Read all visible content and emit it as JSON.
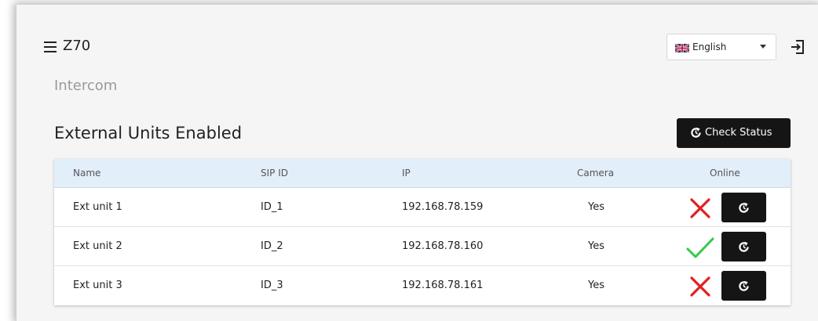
{
  "header": {
    "app_title": "Z70",
    "language": "English"
  },
  "section_title": "Intercom",
  "card": {
    "title": "External Units Enabled",
    "check_status_label": "Check Status"
  },
  "table": {
    "columns": [
      "Name",
      "SIP ID",
      "IP",
      "Camera",
      "Online"
    ],
    "rows": [
      {
        "name": "Ext unit 1",
        "sip_id": "ID_1",
        "ip": "192.168.78.159",
        "camera": "Yes",
        "online": false
      },
      {
        "name": "Ext unit 2",
        "sip_id": "ID_2",
        "ip": "192.168.78.160",
        "camera": "Yes",
        "online": true
      },
      {
        "name": "Ext unit 3",
        "sip_id": "ID_3",
        "ip": "192.168.78.161",
        "camera": "Yes",
        "online": false
      }
    ]
  },
  "colors": {
    "offline": "#e02020",
    "online": "#34c84a",
    "button_bg": "#151515",
    "header_bg": "#e3eefb"
  },
  "icons": {
    "menu": "hamburger-icon",
    "flag": "uk-flag-icon",
    "dropdown": "caret-down-icon",
    "logout": "logout-icon",
    "refresh": "refresh-icon",
    "offline": "cross-icon",
    "online": "check-icon"
  }
}
